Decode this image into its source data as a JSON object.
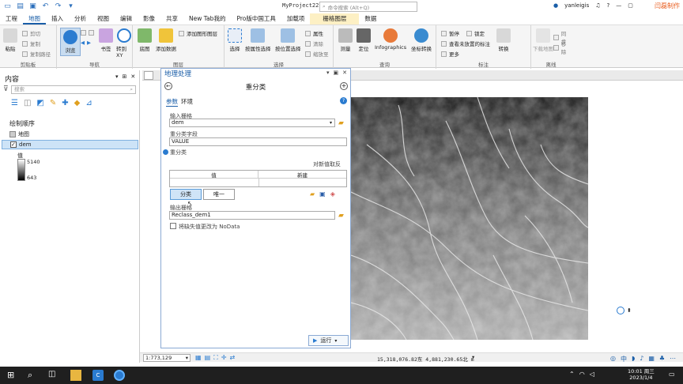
{
  "window": {
    "title": "MyProject22",
    "search_placeholder": "命令搜索 (Alt+Q)",
    "user": "yanleigis",
    "watermark": "闫磊制作"
  },
  "tabs": [
    "工程",
    "地图",
    "插入",
    "分析",
    "视图",
    "编辑",
    "影像",
    "共享",
    "New Tab",
    "我的",
    "Pro版中国工具",
    "加载项",
    "栅格图层",
    "数据"
  ],
  "active_tab": "地图",
  "ribbon": {
    "clipboard": {
      "label": "剪贴板",
      "paste": "粘贴",
      "cut": "剪切",
      "copy": "复制",
      "copy_path": "复制路径"
    },
    "navigate": {
      "label": "导航",
      "explore": "浏览",
      "bookmark": "书签",
      "goto": "转到 XY"
    },
    "layer": {
      "label": "图层",
      "basemap": "底图",
      "add_data": "添加数据",
      "add_graphics": "添加图形图层"
    },
    "selection": {
      "label": "选择",
      "select": "选择",
      "by_attr": "按属性选择",
      "by_loc": "按位置选择",
      "attributes": "属性",
      "clear": "清除",
      "zoom_to": "缩放至"
    },
    "inquiry": {
      "label": "查询",
      "measure": "测量",
      "locate": "定位",
      "infographics": "Infographics",
      "convert": "坐标转换"
    },
    "labeling": {
      "label": "标注",
      "pause": "暂停",
      "lock": "锁定",
      "view_unplaced": "查看未放置的标注",
      "more": "更多",
      "convert": "转换"
    },
    "offline": {
      "label": "离线",
      "download": "下载地图",
      "sync": "同步",
      "remove": "移除"
    }
  },
  "contents": {
    "title": "内容",
    "search_placeholder": "搜索",
    "drawing_order": "绘制顺序",
    "map": "地图",
    "layer": "dem",
    "legend_title": "值",
    "legend_high": "5140",
    "legend_low": "643"
  },
  "gp": {
    "panel_title": "地理处理",
    "tool_title": "重分类",
    "tab_params": "参数",
    "tab_env": "环境",
    "input_raster_label": "输入栅格",
    "input_raster": "dem",
    "reclass_field_label": "重分类字段",
    "reclass_field": "VALUE",
    "reclass_label": "重分类",
    "reverse": "对新值取反",
    "col_value": "值",
    "col_new": "新建",
    "classify_btn": "分类",
    "unique_btn": "唯一",
    "output_label": "输出栅格",
    "output": "Reclass_dem1",
    "nodata_checkbox": "将缺失值更改为 NoData",
    "run": "运行"
  },
  "status": {
    "scale": "1:773,129",
    "coords": "15,318,076.82东  4,881,230.65北 m"
  },
  "taskbar": {
    "time": "10:01 周三",
    "date": "2023/1/4",
    "lang": "中"
  },
  "colors": {
    "accent": "#1a5ea8",
    "ctx_tab": "#fdf0c4",
    "taskbar": "#1f1f1f"
  }
}
